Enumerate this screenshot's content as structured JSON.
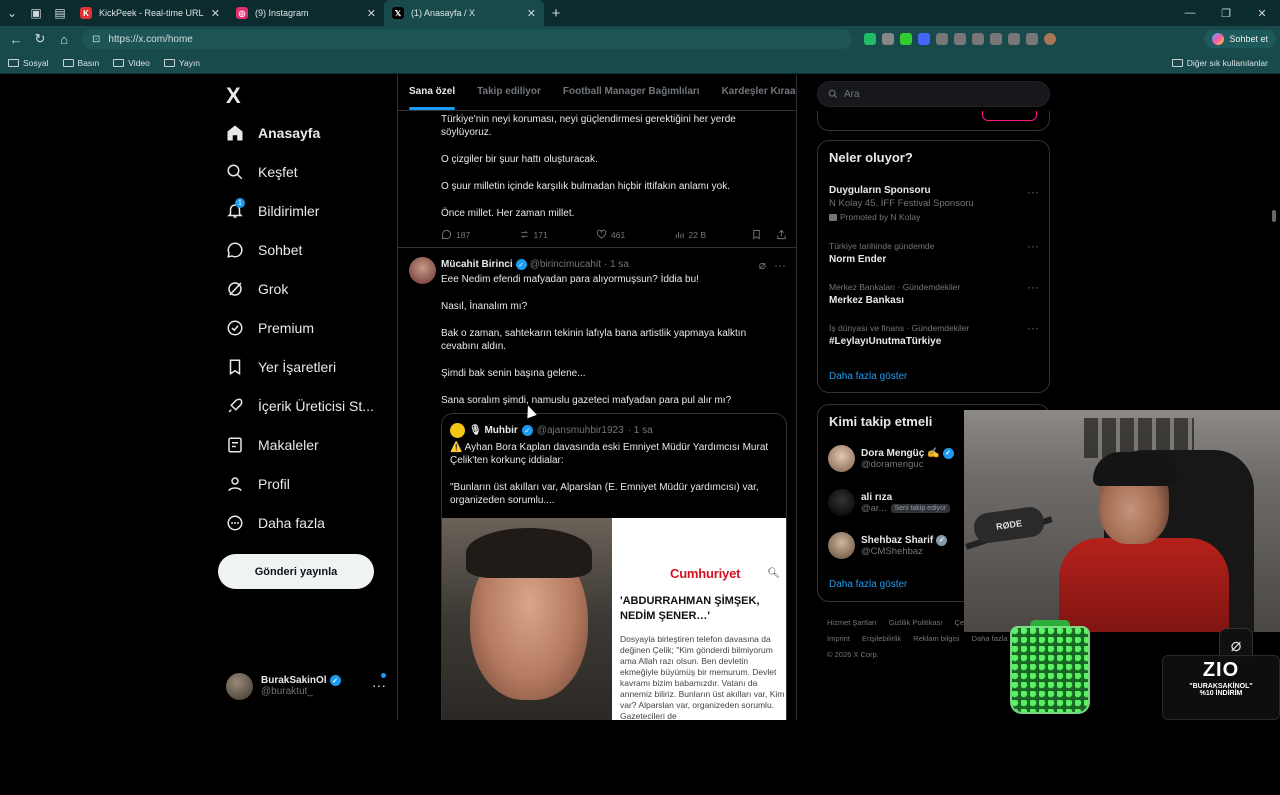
{
  "browser": {
    "tabs": [
      {
        "title": "KickPeek - Real-time URL Crawler",
        "favicon_color": "#d33",
        "active": false
      },
      {
        "title": "(9) Instagram",
        "favicon_color": "#e1306c",
        "active": false
      },
      {
        "title": "(1) Anasayfa / X",
        "favicon_color": "#000000",
        "active": true
      }
    ],
    "new_tab": "+",
    "url": "https://x.com/home",
    "chat_button": "Sohbet et",
    "favorites": [
      "Sosyal",
      "Basın",
      "Video",
      "Yayın"
    ],
    "other_favorites": "Diğer sık kullanılanlar"
  },
  "nav": {
    "logo": "X",
    "items": [
      {
        "label": "Anasayfa",
        "icon": "home-icon"
      },
      {
        "label": "Keşfet",
        "icon": "search-icon"
      },
      {
        "label": "Bildirimler",
        "icon": "bell-icon",
        "badge": "1"
      },
      {
        "label": "Sohbet",
        "icon": "chat-icon"
      },
      {
        "label": "Grok",
        "icon": "grok-icon"
      },
      {
        "label": "Premium",
        "icon": "premium-icon"
      },
      {
        "label": "Yer İşaretleri",
        "icon": "bookmark-icon"
      },
      {
        "label": "İçerik Üreticisi St...",
        "icon": "rocket-icon"
      },
      {
        "label": "Makaleler",
        "icon": "article-icon"
      },
      {
        "label": "Profil",
        "icon": "person-icon"
      },
      {
        "label": "Daha fazla",
        "icon": "more-circle-icon"
      }
    ],
    "post_button": "Gönderi yayınla",
    "account": {
      "name": "BurakSakinOl",
      "handle": "@buraktut_"
    }
  },
  "timeline": {
    "tabs": [
      "Sana özel",
      "Takip ediliyor",
      "Football Manager Bağımlıları",
      "Kardeşler Kıraath"
    ],
    "post1": {
      "paragraphs": [
        "Türkiye'nin neyi koruması, neyi güçlendirmesi gerektiğini her yerde söylüyoruz.",
        "O çizgiler bir şuur hattı oluşturacak.",
        "O şuur milletin içinde karşılık bulmadan hiçbir ittifakın anlamı yok.",
        "Önce millet. Her zaman millet."
      ],
      "replies": "187",
      "reposts": "171",
      "likes": "461",
      "views": "22 B"
    },
    "post2": {
      "name": "Mücahit Birinci",
      "handle": "@birincimucahit",
      "time": "· 1 sa",
      "paragraphs": [
        "Eee Nedim efendi mafyadan para alıyormuşsun? İddia bu!",
        "Nasıl, İnanalım mı?",
        "Bak o zaman, sahtekarın tekinin lafıyla bana artistlik yapmaya kalktın cevabını aldın.",
        "Şimdi bak senin başına gelene...",
        "Sana soralım şimdi, namuslu gazeteci mafyadan para pul alır mı?"
      ],
      "quote": {
        "name": "🎙 Muhbir",
        "handle": "@ajansmuhbir1923",
        "time": "· 1 sa",
        "paragraphs": [
          "⚠️ Ayhan Bora Kaplan davasında eski Emniyet Müdür Yardımcısı Murat Çelik'ten korkunç iddialar:",
          "\"Bunların üst akılları var, Alparslan (E. Emniyet Müdür yardımcısı) var, organizeden sorumlu...."
        ],
        "news_brand": "Cumhuriyet",
        "news_headline": "'ABDURRAHMAN ŞİMŞEK, NEDİM ŞENER…'",
        "news_body": "Dosyayla birleştiren telefon davasına da değinen Çelik; \"Kim gönderdi bilmiyorum ama Allah razı olsun. Ben devletin ekmeğiyle büyümüş bir memurum. Devlet kavramı bizim babamızdır. Vatanı da annemiz biliriz. Bunların üst akılları var, Kim var? Alparslan var, organizeden sorumlu. Gazetecileri de"
      }
    }
  },
  "sidebar": {
    "search_placeholder": "Ara",
    "trends_title": "Neler oluyor?",
    "trends": [
      {
        "context": "",
        "title": "Duyguların Sponsoru",
        "subtitle": "N Kolay 45. İFF Festival Sponsoru",
        "promo": "Promoted by N Kolay"
      },
      {
        "context": "Türkiye tarihinde gündemde",
        "title": "Norm Ender",
        "subtitle": "",
        "promo": ""
      },
      {
        "context": "Merkez Bankaları · Gündemdekiler",
        "title": "Merkez Bankası",
        "subtitle": "",
        "promo": ""
      },
      {
        "context": "İş dünyası ve finans · Gündemdekiler",
        "title": "#LeylayıUnutmaTürkiye",
        "subtitle": "",
        "promo": ""
      }
    ],
    "trends_more": "Daha fazla göster",
    "follow_title": "Kimi takip etmeli",
    "follow": [
      {
        "name": "Dora Mengüç ✍",
        "handle": "@doramenguc",
        "chip": ""
      },
      {
        "name": "ali rıza",
        "handle": "@ar...",
        "chip": "Seni takip ediyor"
      },
      {
        "name": "Shehbaz Sharif",
        "handle": "@CMShehbaz",
        "chip": ""
      }
    ],
    "follow_more": "Daha fazla göster",
    "footer_links": [
      "Hizmet Şartları",
      "Gizlilik Politikası",
      "Çerez Politikası",
      "Imprint",
      "Erişilebilirlik",
      "Reklam bilgisi",
      "Daha fazla",
      "© 2026 X Corp."
    ]
  },
  "overlay": {
    "mic_brand": "RØDE",
    "promo_logo": "ZIO",
    "promo_code": "\"BURAKSAKİNOL\"",
    "promo_discount": "%10 İNDİRİM"
  },
  "colors": {
    "accent": "#1d9bf0",
    "background": "#000000",
    "chrome": "#184a4c"
  }
}
